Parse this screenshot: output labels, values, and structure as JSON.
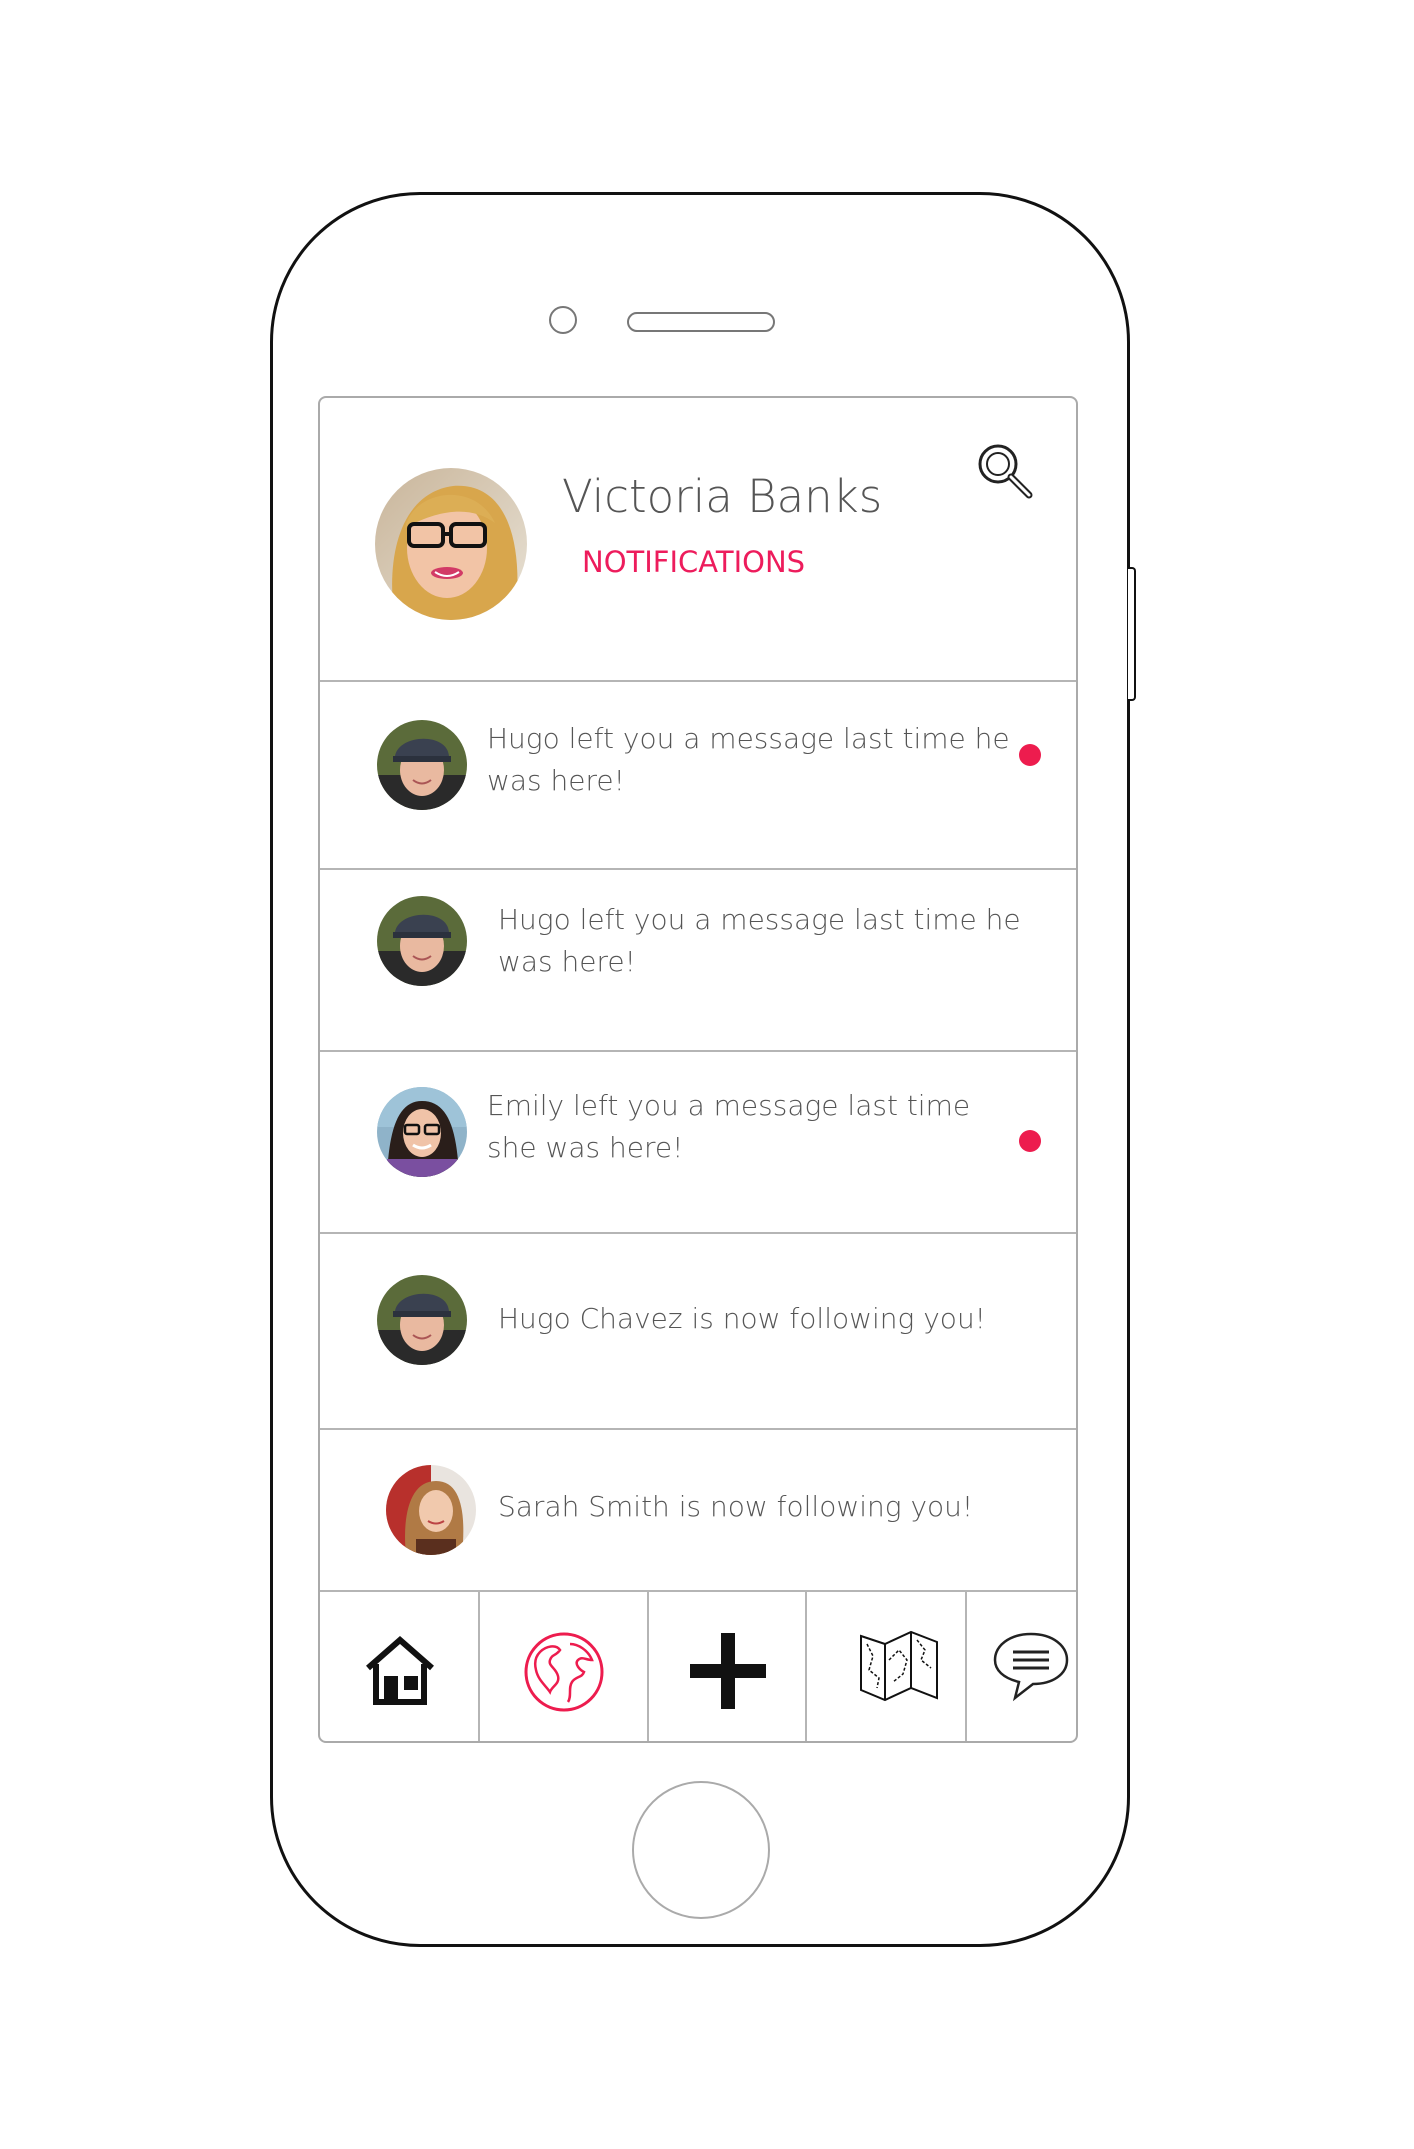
{
  "header": {
    "user_name": "Victoria Banks",
    "section_title": "NOTIFICATIONS"
  },
  "notifications": [
    {
      "text_line1": "Hugo left you a message last time he",
      "text_line2": "was here!",
      "unread": true,
      "avatar": "hugo-avatar"
    },
    {
      "text_line1": "Hugo left you a message last time he",
      "text_line2": "was here!",
      "unread": false,
      "avatar": "hugo-avatar"
    },
    {
      "text_line1": "Emily left you a message last time",
      "text_line2": "she was here!",
      "unread": true,
      "avatar": "emily-avatar"
    },
    {
      "text_line1": "Hugo Chavez is now following you!",
      "text_line2": "",
      "unread": false,
      "avatar": "hugo-avatar"
    },
    {
      "text_line1": "Sarah Smith is now following you!",
      "text_line2": "",
      "unread": false,
      "avatar": "sarah-avatar"
    }
  ],
  "tabbar": {
    "tabs": [
      {
        "icon": "home-icon",
        "active": false
      },
      {
        "icon": "globe-icon",
        "active": true
      },
      {
        "icon": "plus-icon",
        "active": false
      },
      {
        "icon": "map-icon",
        "active": false
      },
      {
        "icon": "chat-bubble-icon",
        "active": false
      }
    ]
  },
  "colors": {
    "accent": "#ed1c5c",
    "unread_dot": "#ed1c4e",
    "text": "#555555",
    "divider": "#b5b5b5"
  }
}
